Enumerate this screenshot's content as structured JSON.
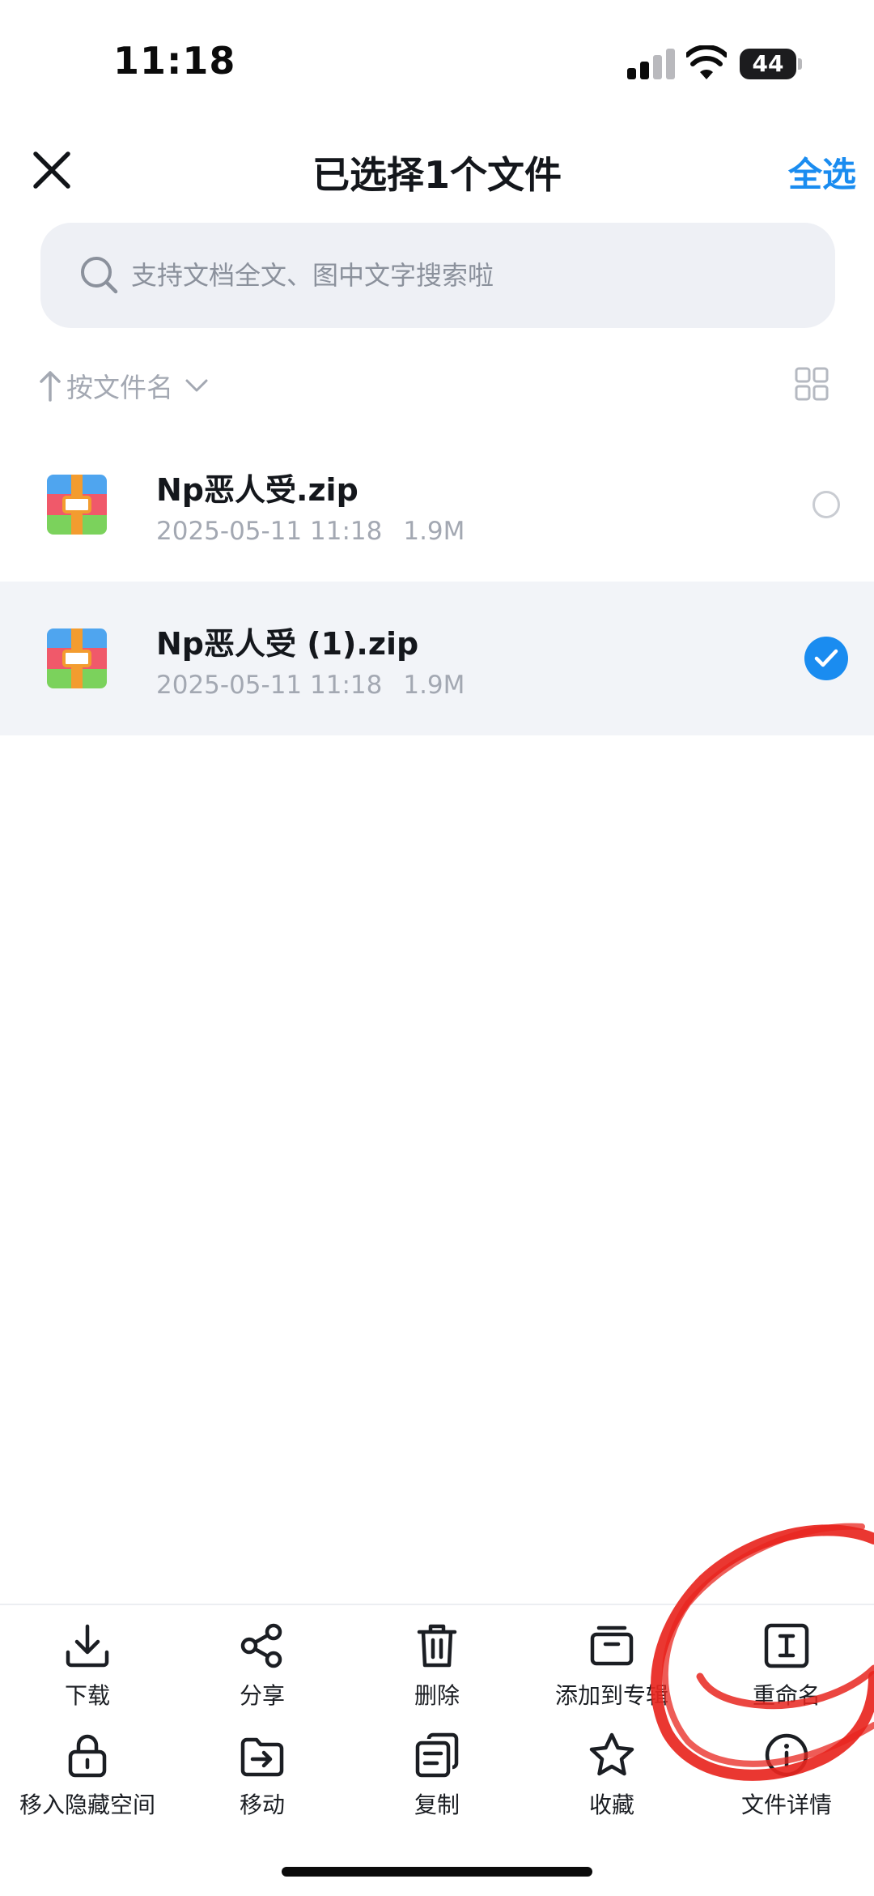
{
  "status_bar": {
    "time": "11:18",
    "battery": "44"
  },
  "header": {
    "title": "已选择1个文件",
    "select_all": "全选"
  },
  "search": {
    "placeholder": "支持文档全文、图中文字搜索啦"
  },
  "sort": {
    "label": "按文件名"
  },
  "files": [
    {
      "name": "Np恶人受.zip",
      "date": "2025-05-11 11:18",
      "size": "1.9M",
      "selected": false
    },
    {
      "name": "Np恶人受 (1).zip",
      "date": "2025-05-11 11:18",
      "size": "1.9M",
      "selected": true
    }
  ],
  "actions": [
    {
      "label": "下载",
      "icon": "download-icon"
    },
    {
      "label": "分享",
      "icon": "share-icon"
    },
    {
      "label": "删除",
      "icon": "trash-icon"
    },
    {
      "label": "添加到专辑",
      "icon": "album-icon"
    },
    {
      "label": "重命名",
      "icon": "rename-icon"
    },
    {
      "label": "移入隐藏空间",
      "icon": "lock-icon"
    },
    {
      "label": "移动",
      "icon": "move-icon"
    },
    {
      "label": "复制",
      "icon": "copy-icon"
    },
    {
      "label": "收藏",
      "icon": "star-icon"
    },
    {
      "label": "文件详情",
      "icon": "info-icon"
    }
  ],
  "colors": {
    "accent": "#1a8cf0",
    "selected_row": "#f2f4f8",
    "annotation": "#e8261f"
  }
}
